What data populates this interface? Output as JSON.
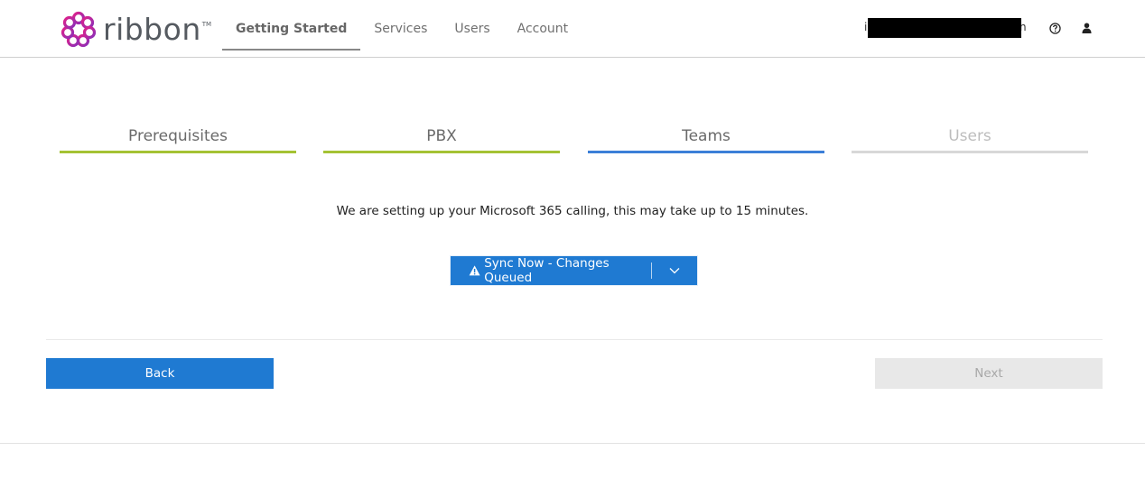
{
  "header": {
    "logo_text": "ribbon",
    "logo_tm": "TM",
    "nav": [
      {
        "label": "Getting Started",
        "active": true
      },
      {
        "label": "Services",
        "active": false
      },
      {
        "label": "Users",
        "active": false
      },
      {
        "label": "Account",
        "active": false
      }
    ],
    "user_partial_start": "i",
    "user_partial_end": "n",
    "icons": {
      "help": "help-circle-icon",
      "user": "user-icon"
    }
  },
  "steps": [
    {
      "label": "Prerequisites",
      "state": "complete",
      "color": "#a4c234"
    },
    {
      "label": "PBX",
      "state": "complete",
      "color": "#a4c234"
    },
    {
      "label": "Teams",
      "state": "current",
      "color": "#3b7fd8"
    },
    {
      "label": "Users",
      "state": "upcoming",
      "color": "#d8d8d8"
    }
  ],
  "message": "We are setting up your Microsoft 365 calling, this may take up to 15 minutes.",
  "sync_button": {
    "label": "Sync Now - Changes Queued",
    "icon": "warning-icon",
    "caret_icon": "chevron-down-icon"
  },
  "footer": {
    "back_label": "Back",
    "next_label": "Next",
    "next_disabled": true
  },
  "colors": {
    "primary": "#1f7ad2",
    "brand_magenta": "#c2178f"
  }
}
